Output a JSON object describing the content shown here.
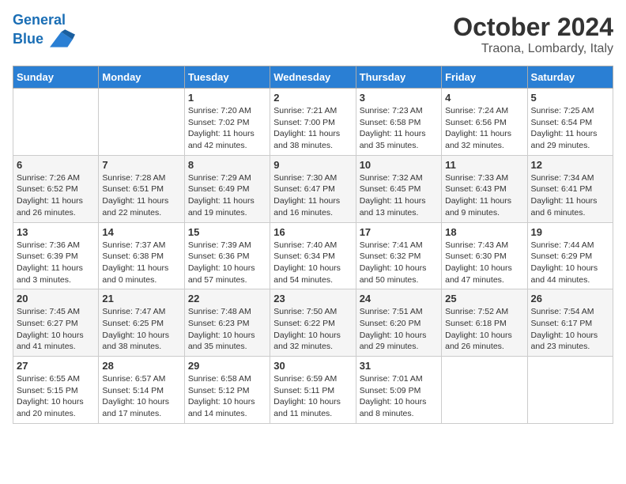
{
  "header": {
    "logo_line1": "General",
    "logo_line2": "Blue",
    "title": "October 2024",
    "subtitle": "Traona, Lombardy, Italy"
  },
  "weekdays": [
    "Sunday",
    "Monday",
    "Tuesday",
    "Wednesday",
    "Thursday",
    "Friday",
    "Saturday"
  ],
  "weeks": [
    [
      {
        "day": "",
        "detail": ""
      },
      {
        "day": "",
        "detail": ""
      },
      {
        "day": "1",
        "detail": "Sunrise: 7:20 AM\nSunset: 7:02 PM\nDaylight: 11 hours and 42 minutes."
      },
      {
        "day": "2",
        "detail": "Sunrise: 7:21 AM\nSunset: 7:00 PM\nDaylight: 11 hours and 38 minutes."
      },
      {
        "day": "3",
        "detail": "Sunrise: 7:23 AM\nSunset: 6:58 PM\nDaylight: 11 hours and 35 minutes."
      },
      {
        "day": "4",
        "detail": "Sunrise: 7:24 AM\nSunset: 6:56 PM\nDaylight: 11 hours and 32 minutes."
      },
      {
        "day": "5",
        "detail": "Sunrise: 7:25 AM\nSunset: 6:54 PM\nDaylight: 11 hours and 29 minutes."
      }
    ],
    [
      {
        "day": "6",
        "detail": "Sunrise: 7:26 AM\nSunset: 6:52 PM\nDaylight: 11 hours and 26 minutes."
      },
      {
        "day": "7",
        "detail": "Sunrise: 7:28 AM\nSunset: 6:51 PM\nDaylight: 11 hours and 22 minutes."
      },
      {
        "day": "8",
        "detail": "Sunrise: 7:29 AM\nSunset: 6:49 PM\nDaylight: 11 hours and 19 minutes."
      },
      {
        "day": "9",
        "detail": "Sunrise: 7:30 AM\nSunset: 6:47 PM\nDaylight: 11 hours and 16 minutes."
      },
      {
        "day": "10",
        "detail": "Sunrise: 7:32 AM\nSunset: 6:45 PM\nDaylight: 11 hours and 13 minutes."
      },
      {
        "day": "11",
        "detail": "Sunrise: 7:33 AM\nSunset: 6:43 PM\nDaylight: 11 hours and 9 minutes."
      },
      {
        "day": "12",
        "detail": "Sunrise: 7:34 AM\nSunset: 6:41 PM\nDaylight: 11 hours and 6 minutes."
      }
    ],
    [
      {
        "day": "13",
        "detail": "Sunrise: 7:36 AM\nSunset: 6:39 PM\nDaylight: 11 hours and 3 minutes."
      },
      {
        "day": "14",
        "detail": "Sunrise: 7:37 AM\nSunset: 6:38 PM\nDaylight: 11 hours and 0 minutes."
      },
      {
        "day": "15",
        "detail": "Sunrise: 7:39 AM\nSunset: 6:36 PM\nDaylight: 10 hours and 57 minutes."
      },
      {
        "day": "16",
        "detail": "Sunrise: 7:40 AM\nSunset: 6:34 PM\nDaylight: 10 hours and 54 minutes."
      },
      {
        "day": "17",
        "detail": "Sunrise: 7:41 AM\nSunset: 6:32 PM\nDaylight: 10 hours and 50 minutes."
      },
      {
        "day": "18",
        "detail": "Sunrise: 7:43 AM\nSunset: 6:30 PM\nDaylight: 10 hours and 47 minutes."
      },
      {
        "day": "19",
        "detail": "Sunrise: 7:44 AM\nSunset: 6:29 PM\nDaylight: 10 hours and 44 minutes."
      }
    ],
    [
      {
        "day": "20",
        "detail": "Sunrise: 7:45 AM\nSunset: 6:27 PM\nDaylight: 10 hours and 41 minutes."
      },
      {
        "day": "21",
        "detail": "Sunrise: 7:47 AM\nSunset: 6:25 PM\nDaylight: 10 hours and 38 minutes."
      },
      {
        "day": "22",
        "detail": "Sunrise: 7:48 AM\nSunset: 6:23 PM\nDaylight: 10 hours and 35 minutes."
      },
      {
        "day": "23",
        "detail": "Sunrise: 7:50 AM\nSunset: 6:22 PM\nDaylight: 10 hours and 32 minutes."
      },
      {
        "day": "24",
        "detail": "Sunrise: 7:51 AM\nSunset: 6:20 PM\nDaylight: 10 hours and 29 minutes."
      },
      {
        "day": "25",
        "detail": "Sunrise: 7:52 AM\nSunset: 6:18 PM\nDaylight: 10 hours and 26 minutes."
      },
      {
        "day": "26",
        "detail": "Sunrise: 7:54 AM\nSunset: 6:17 PM\nDaylight: 10 hours and 23 minutes."
      }
    ],
    [
      {
        "day": "27",
        "detail": "Sunrise: 6:55 AM\nSunset: 5:15 PM\nDaylight: 10 hours and 20 minutes."
      },
      {
        "day": "28",
        "detail": "Sunrise: 6:57 AM\nSunset: 5:14 PM\nDaylight: 10 hours and 17 minutes."
      },
      {
        "day": "29",
        "detail": "Sunrise: 6:58 AM\nSunset: 5:12 PM\nDaylight: 10 hours and 14 minutes."
      },
      {
        "day": "30",
        "detail": "Sunrise: 6:59 AM\nSunset: 5:11 PM\nDaylight: 10 hours and 11 minutes."
      },
      {
        "day": "31",
        "detail": "Sunrise: 7:01 AM\nSunset: 5:09 PM\nDaylight: 10 hours and 8 minutes."
      },
      {
        "day": "",
        "detail": ""
      },
      {
        "day": "",
        "detail": ""
      }
    ]
  ]
}
